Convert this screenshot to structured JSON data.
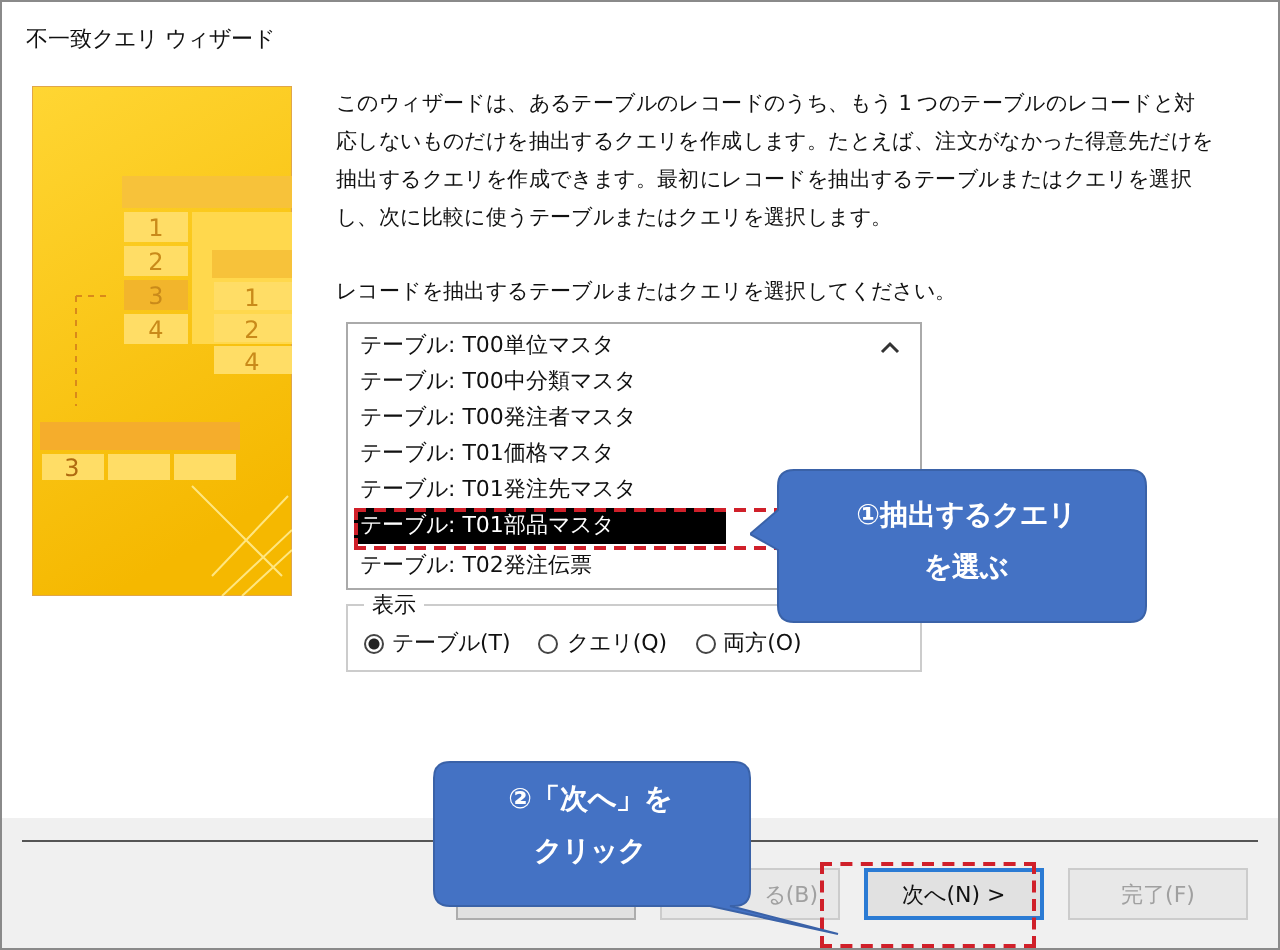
{
  "window": {
    "title": "不一致クエリ ウィザード"
  },
  "illustration": {
    "left_table": [
      "1",
      "2",
      "3",
      "4"
    ],
    "right_table": [
      "1",
      "2",
      "4"
    ],
    "result_table": [
      "3"
    ]
  },
  "description": "このウィザードは、あるテーブルのレコードのうち、もう 1 つのテーブルのレコードと対応しないものだけを抽出するクエリを作成します。たとえば、注文がなかった得意先だけを抽出するクエリを作成できます。最初にレコードを抽出するテーブルまたはクエリを選択し、次に比較に使うテーブルまたはクエリを選択します。",
  "prompt": "レコードを抽出するテーブルまたはクエリを選択してください。",
  "list": [
    {
      "label": "テーブル: T00単位マスタ",
      "selected": false
    },
    {
      "label": "テーブル: T00中分類マスタ",
      "selected": false
    },
    {
      "label": "テーブル: T00発注者マスタ",
      "selected": false
    },
    {
      "label": "テーブル: T01価格マスタ",
      "selected": false
    },
    {
      "label": "テーブル: T01発注先マスタ",
      "selected": false
    },
    {
      "label": "テーブル: T01部品マスタ",
      "selected": true
    },
    {
      "label": "テーブル: T02発注伝票",
      "selected": false
    }
  ],
  "view_group": {
    "label": "表示",
    "options": [
      {
        "label": "テーブル(T)",
        "selected": true
      },
      {
        "label": "クエリ(Q)",
        "selected": false
      },
      {
        "label": "両方(O)",
        "selected": false
      }
    ]
  },
  "buttons": [
    {
      "disabled": false,
      "focused": false
    },
    {
      "label": "る(B)",
      "disabled": true,
      "focused": false
    },
    {
      "label": "次へ(N) >",
      "disabled": false,
      "focused": true
    },
    {
      "label": "完了(F)",
      "disabled": true,
      "focused": false
    }
  ],
  "callouts": [
    {
      "lines": [
        "①抽出するクエリ",
        "を選ぶ"
      ]
    },
    {
      "lines": [
        "②「次へ」を",
        "クリック"
      ]
    }
  ]
}
